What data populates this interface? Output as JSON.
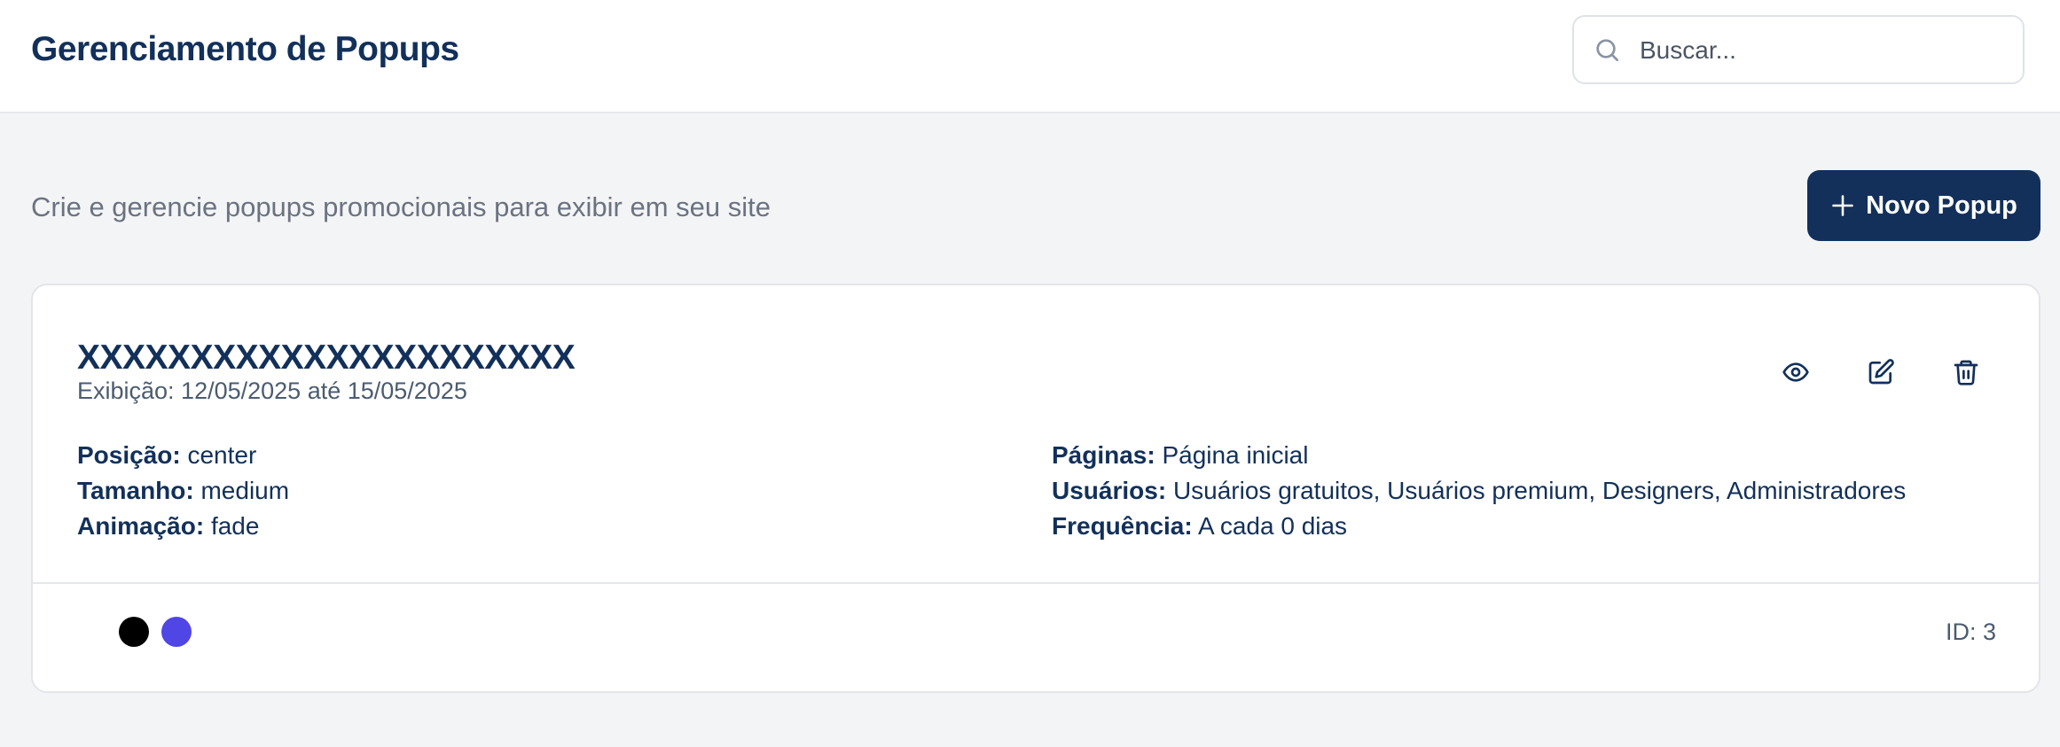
{
  "header": {
    "title": "Gerenciamento de Popups",
    "search_placeholder": "Buscar..."
  },
  "toolbar": {
    "subtitle": "Crie e gerencie popups promocionais para exibir em seu site",
    "new_popup_label": "Novo Popup"
  },
  "popups": [
    {
      "name": "XXXXXXXXXXXXXXXXXXXXXX",
      "display_period": "Exibição: 12/05/2025 até 15/05/2025",
      "details_left": [
        {
          "label": "Posição:",
          "value": "center"
        },
        {
          "label": "Tamanho:",
          "value": "medium"
        },
        {
          "label": "Animação:",
          "value": "fade"
        }
      ],
      "details_right": [
        {
          "label": "Páginas:",
          "value": "Página inicial"
        },
        {
          "label": "Usuários:",
          "value": "Usuários gratuitos, Usuários premium, Designers, Administradores"
        },
        {
          "label": "Frequência:",
          "value": "A cada 0 dias"
        }
      ],
      "colors": {
        "background": "#000000",
        "accent": "#4f46e5"
      },
      "id_label": "ID: 3",
      "action_icons": [
        "eye-icon",
        "edit-icon",
        "trash-icon"
      ]
    }
  ],
  "theme": {
    "primary": "#12305a",
    "page_background": "#f3f4f6"
  }
}
